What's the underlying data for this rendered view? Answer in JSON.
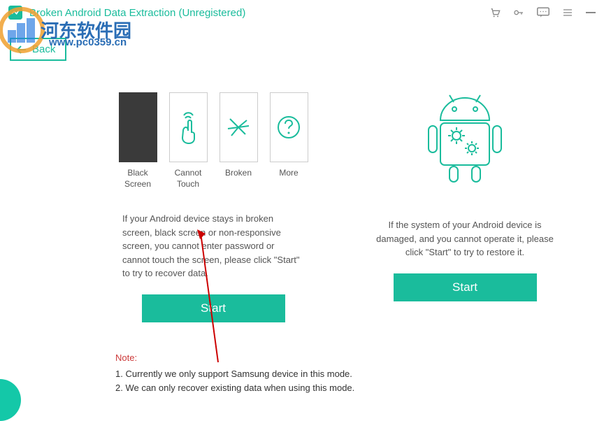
{
  "titlebar": {
    "title": "Broken Android Data Extraction (Unregistered)"
  },
  "back": {
    "label": "Back"
  },
  "left": {
    "options": [
      {
        "label": "Black Screen",
        "kind": "black"
      },
      {
        "label": "Cannot Touch",
        "kind": "touch"
      },
      {
        "label": "Broken",
        "kind": "broken"
      },
      {
        "label": "More",
        "kind": "more"
      }
    ],
    "desc": "If your Android device stays in broken screen, black screen or non-responsive screen, you cannot enter password or cannot touch the screen, please click \"Start\" to try to recover data.",
    "start": "Start"
  },
  "right": {
    "desc": "If the system of your Android device is damaged, and you cannot operate it, please click \"Start\" to try to restore it.",
    "start": "Start"
  },
  "notes": {
    "header": "Note:",
    "line1": "1. Currently we only support Samsung device in this mode.",
    "line2": "2. We can only recover existing data when using this mode."
  },
  "watermark": {
    "cn": "河东软件园",
    "url": "www.pc0359.cn"
  },
  "colors": {
    "accent": "#1abc9c"
  }
}
